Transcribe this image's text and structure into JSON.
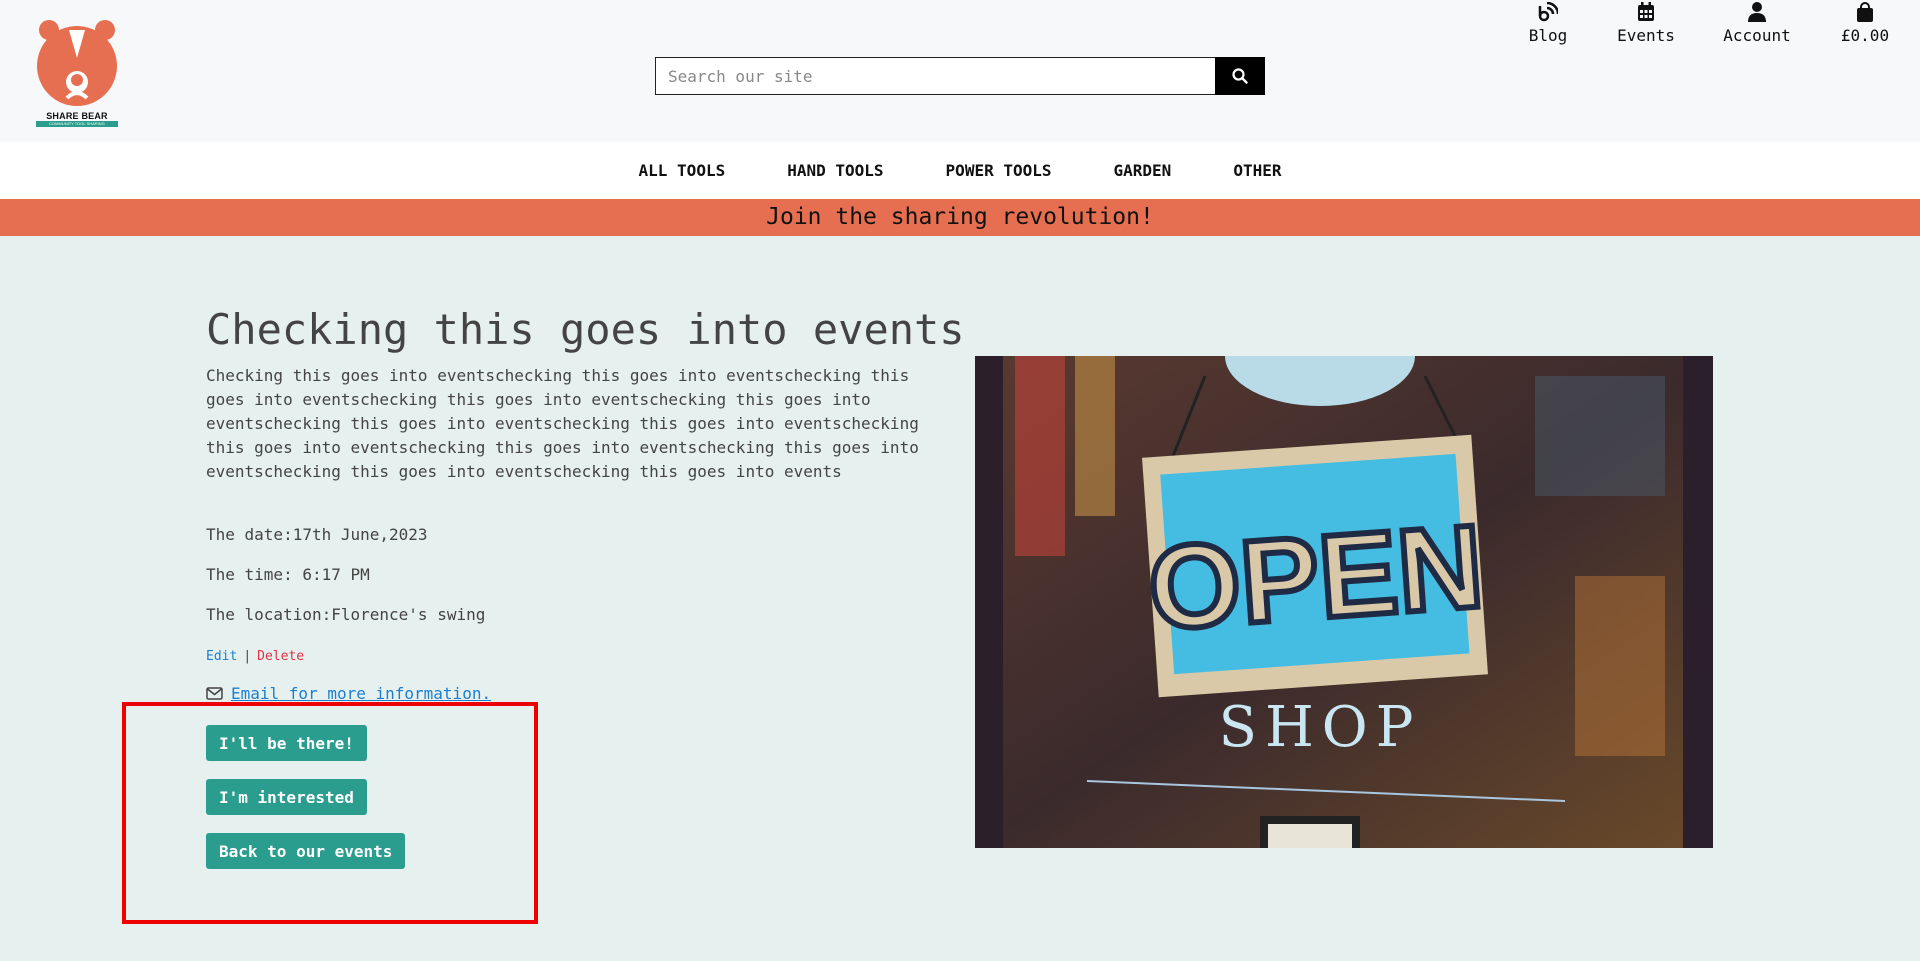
{
  "brand": {
    "logo_text": "SHARE BEAR",
    "logo_subtext": "COMMUNITY TOOL SHARING",
    "color_primary": "#e76f51",
    "color_accent": "#2a9d8f"
  },
  "search": {
    "placeholder": "Search our site",
    "value": "",
    "icon": "search-icon"
  },
  "header_links": [
    {
      "label": "Blog",
      "icon": "blog-icon"
    },
    {
      "label": "Events",
      "icon": "calendar-icon"
    },
    {
      "label": "Account",
      "icon": "user-icon"
    },
    {
      "label": "£0.00",
      "icon": "bag-icon"
    }
  ],
  "nav": {
    "items": [
      "ALL TOOLS",
      "HAND TOOLS",
      "POWER TOOLS",
      "GARDEN",
      "OTHER"
    ]
  },
  "banner": {
    "text": "Join the sharing revolution!"
  },
  "event": {
    "title": "Checking this goes into events",
    "description": "Checking this goes into eventschecking this goes into eventschecking this goes into eventschecking this goes into eventschecking this goes into eventschecking this goes into eventschecking this goes into eventschecking this goes into eventschecking this goes into eventschecking this goes into eventschecking this goes into eventschecking this goes into events",
    "date": "The date:17th June,2023",
    "time": "The time: 6:17 PM",
    "location": "The location:Florence's swing",
    "edit_label": "Edit",
    "separator": "|",
    "delete_label": "Delete",
    "email_label": "Email for more information."
  },
  "buttons": {
    "attend": "I'll be there!",
    "interested": "I'm interested",
    "back": "Back to our events"
  },
  "image": {
    "sign_text": "OPEN",
    "shop_text": "SHOP"
  }
}
